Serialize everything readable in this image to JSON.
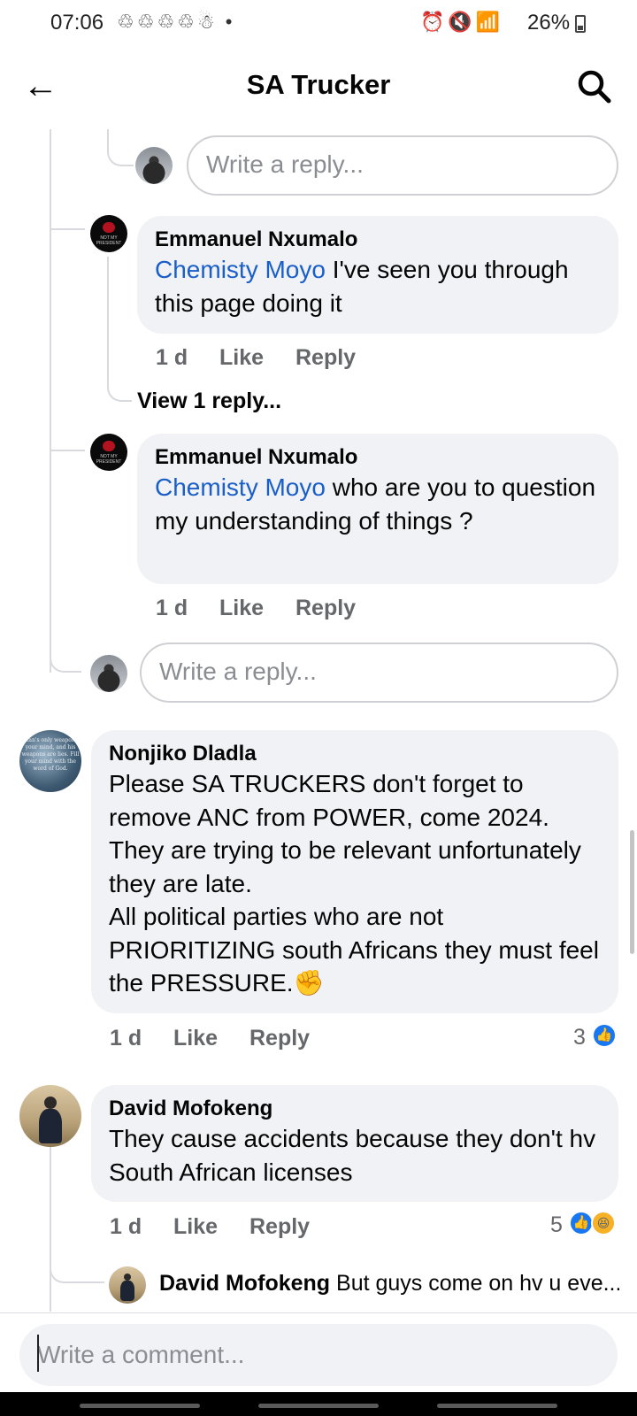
{
  "status_bar": {
    "time": "07:06",
    "notification_icons": "♲♲♲♲☃ •",
    "system_icons": "⏰🔇📶",
    "battery": "26%"
  },
  "header": {
    "back_icon": "←",
    "title": "SA Trucker",
    "search_icon": "search-icon"
  },
  "reply_placeholder": "Write a reply...",
  "comments": {
    "e1": {
      "author": "Emmanuel Nxumalo",
      "mention": "Chemisty Moyo",
      "text": " I've seen you through this page doing it",
      "time": "1 d",
      "like": "Like",
      "reply": "Reply",
      "avatar_text": "NOT MY PRESIDENT"
    },
    "view_replies": "View 1 reply...",
    "e2": {
      "author": "Emmanuel Nxumalo",
      "mention": "Chemisty Moyo",
      "text": " who are you to question my understanding of things ?",
      "time": "1 d",
      "like": "Like",
      "reply": "Reply",
      "avatar_text": "NOT MY PRESIDENT"
    },
    "nonjiko": {
      "author": "Nonjiko Dladla",
      "text": "Please SA TRUCKERS don't forget to remove ANC from POWER, come 2024. They are trying to be relevant unfortunately they are late.\nAll political parties who are not PRIORITIZING south Africans they must feel the PRESSURE.✊",
      "time": "1 d",
      "like": "Like",
      "reply": "Reply",
      "reaction_count": "3",
      "avatar_text": "Satan's only weapon is your mind, and his weapons are lies. Fill your mind with the word of God."
    },
    "david": {
      "author": "David Mofokeng",
      "text": "They cause accidents because they don't hv South African licenses",
      "time": "1 d",
      "like": "Like",
      "reply": "Reply",
      "reaction_count": "5"
    },
    "david_reply": {
      "author": "David Mofokeng",
      "preview": "But guys come on hv u eve..."
    }
  },
  "composer": {
    "placeholder": "Write a comment..."
  },
  "colors": {
    "mention": "#1a5fc7",
    "bubble": "#f0f2f5",
    "like_blue": "#1877f2",
    "muted_text": "#65676b"
  }
}
